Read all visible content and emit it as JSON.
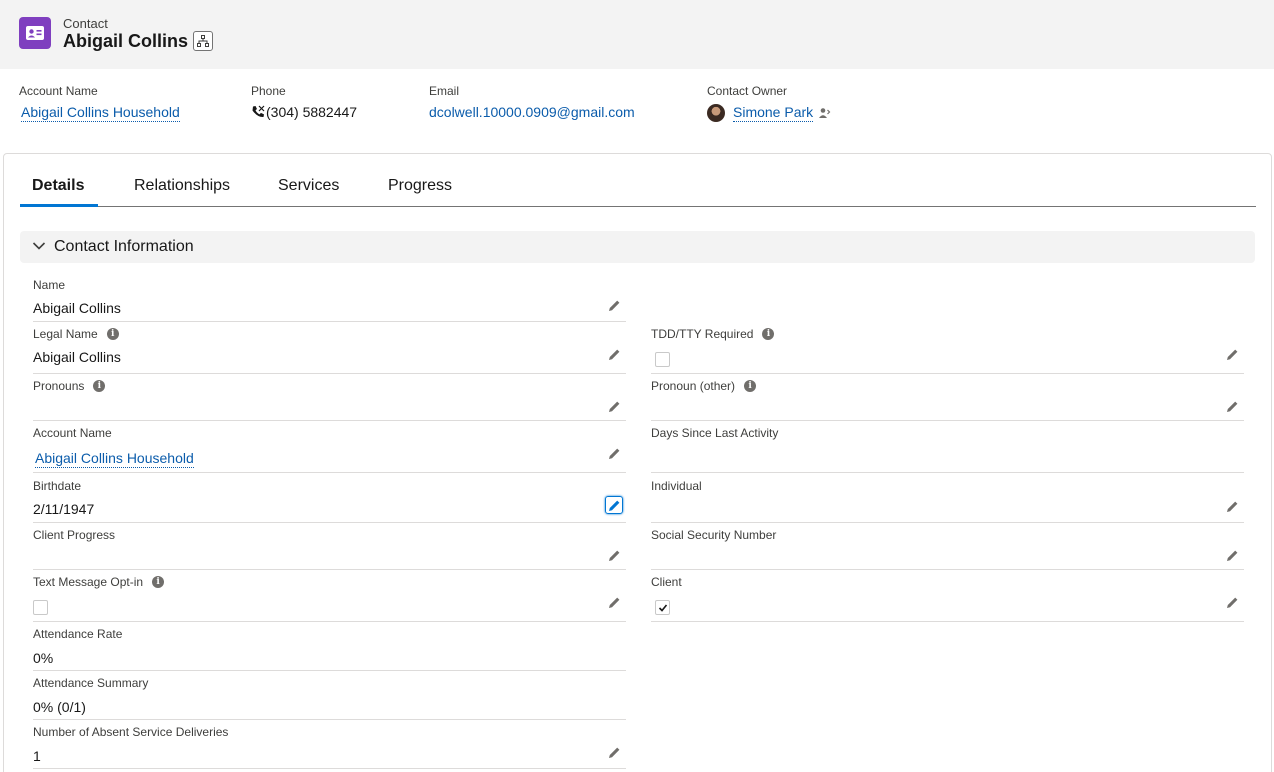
{
  "header": {
    "object_label": "Contact",
    "record_title": "Abigail Collins",
    "icons": {
      "object": "contact-card-icon",
      "hierarchy": "hierarchy-icon"
    }
  },
  "highlights": {
    "account_name": {
      "label": "Account Name",
      "value": "Abigail Collins Household"
    },
    "phone": {
      "label": "Phone",
      "value": "(304) 5882447"
    },
    "email": {
      "label": "Email",
      "value": "dcolwell.10000.0909@gmail.com"
    },
    "owner": {
      "label": "Contact Owner",
      "value": "Simone Park"
    }
  },
  "tabs": [
    {
      "label": "Details",
      "active": true
    },
    {
      "label": "Relationships"
    },
    {
      "label": "Services"
    },
    {
      "label": "Progress"
    }
  ],
  "section": {
    "title": "Contact Information"
  },
  "fields_left": [
    {
      "label": "Name",
      "value": "Abigail Collins"
    },
    {
      "label": "Legal Name",
      "value": "Abigail Collins"
    },
    {
      "label": "Pronouns",
      "value": ""
    },
    {
      "label": "Account Name",
      "value": "Abigail Collins Household"
    },
    {
      "label": "Birthdate",
      "value": "2/11/1947"
    },
    {
      "label": "Client Progress",
      "value": ""
    },
    {
      "label": "Text Message Opt-in",
      "value": ""
    },
    {
      "label": "Attendance Rate",
      "value": "0%"
    },
    {
      "label": "Attendance Summary",
      "value": "0% (0/1)"
    },
    {
      "label": "Number of Absent Service Deliveries",
      "value": "1"
    }
  ],
  "fields_right": [
    {
      "label": "TDD/TTY Required",
      "value": ""
    },
    {
      "label": "Pronoun (other)",
      "value": ""
    },
    {
      "label": "Days Since Last Activity",
      "value": ""
    },
    {
      "label": "Individual",
      "value": ""
    },
    {
      "label": "Social Security Number",
      "value": ""
    },
    {
      "label": "Client",
      "checked": true
    }
  ],
  "colors": {
    "brand_purple": "#7f3fbf",
    "link": "#0b5cab",
    "active_tab": "#0176d3"
  }
}
